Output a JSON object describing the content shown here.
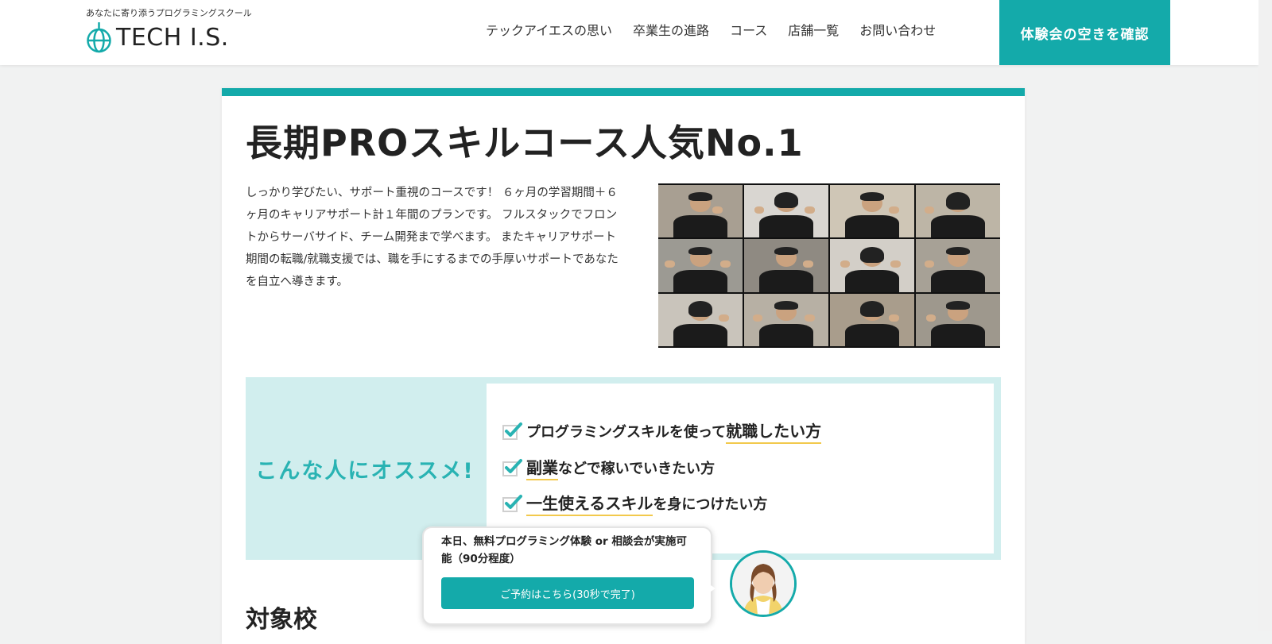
{
  "header": {
    "tagline": "あなたに寄り添うプログラミングスクール",
    "logo_text": "TECH I.S.",
    "nav": [
      {
        "label": "テックアイエスの思い"
      },
      {
        "label": "卒業生の進路"
      },
      {
        "label": "コース"
      },
      {
        "label": "店舗一覧"
      },
      {
        "label": "お問い合わせ"
      }
    ],
    "cta_label": "体験会の空きを確認"
  },
  "course": {
    "title": "長期PROスキルコース人気No.1",
    "description": "しっかり学びたい、サポート重視のコースです！ ６ヶ月の学習期間＋６ヶ月のキャリアサポート計１年間のプランです。 フルスタックでフロントからサーバサイド、チーム開発まで学べます。 またキャリアサポート期間の転職/就職支援では、職を手にするまでの手厚いサポートであなたを自立へ導きます。"
  },
  "recommend": {
    "label": "こんな人にオススメ!",
    "items": [
      {
        "pre": "プログラミングスキルを使って",
        "highlight": "就職したい方",
        "post": ""
      },
      {
        "pre": "",
        "highlight": "副業",
        "post": "などで稼いでいきたい方"
      },
      {
        "pre": "",
        "highlight": "一生使えるスキル",
        "post": "を身につけたい方"
      }
    ]
  },
  "section_title": "対象校",
  "popup": {
    "text": "本日、無料プログラミング体験 or 相談会が実施可能（90分程度）",
    "button_label": "ご予約はこちら(30秒で完了)"
  },
  "colors": {
    "accent": "#14aaaa",
    "recommend_bg": "#d1eeee",
    "highlight_underline": "#f2c94c"
  }
}
